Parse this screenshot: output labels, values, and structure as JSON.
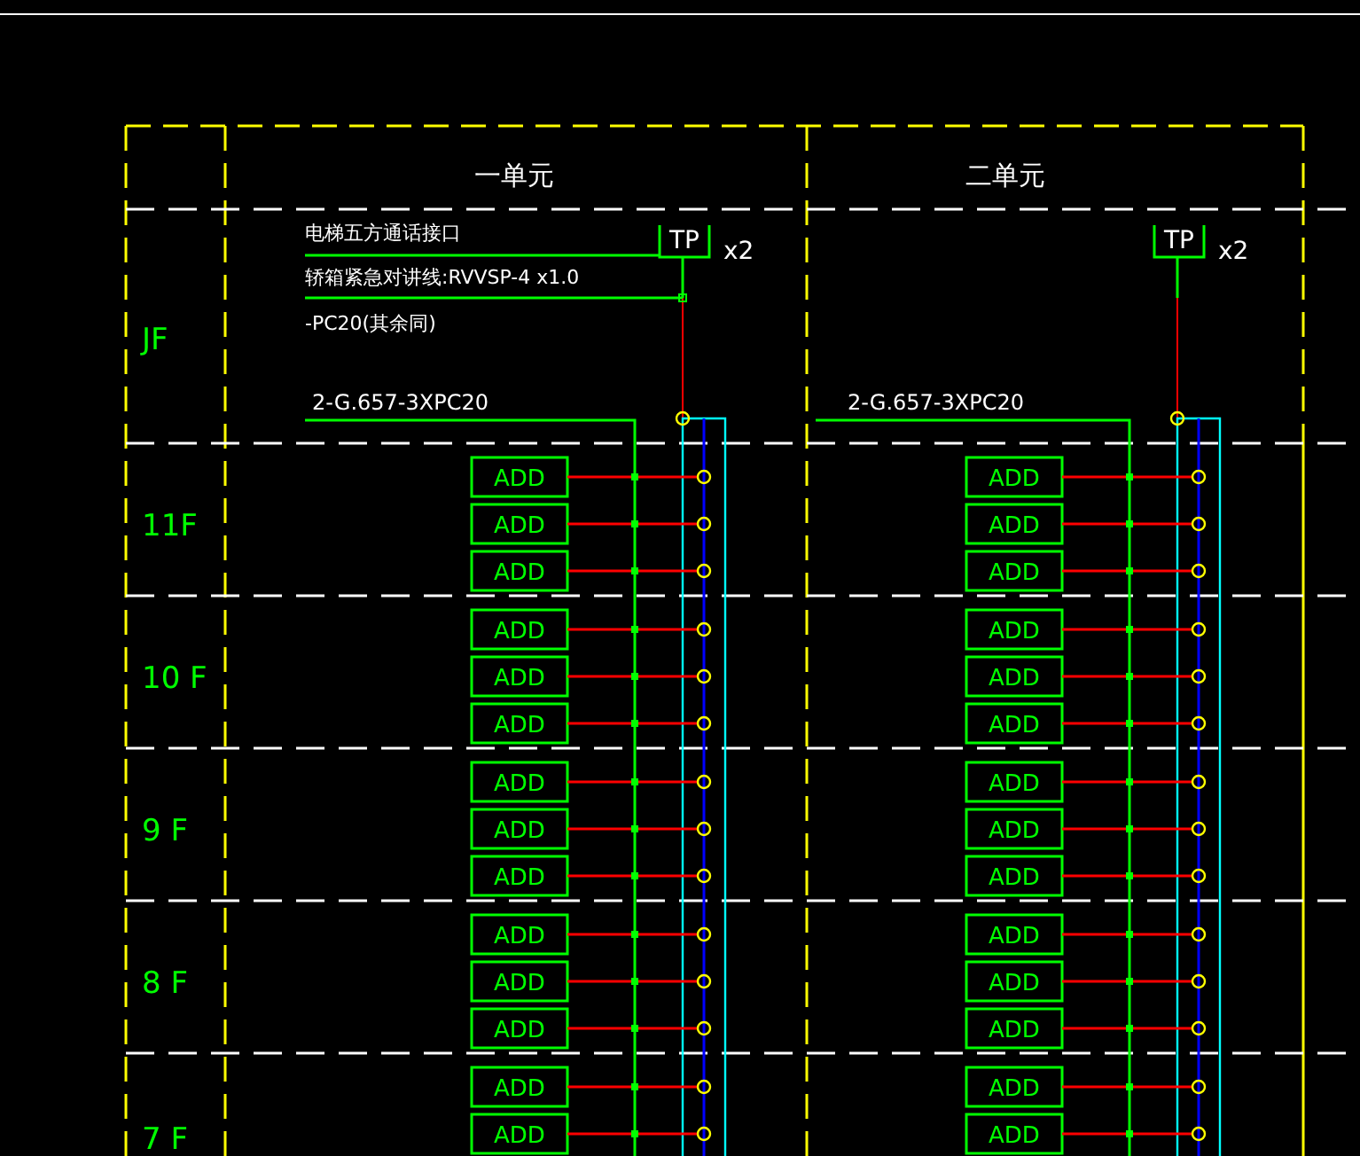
{
  "drawing": {
    "floors": [
      {
        "label": "JF"
      },
      {
        "label": "11F"
      },
      {
        "label": "10 F"
      },
      {
        "label": "9 F"
      },
      {
        "label": "8 F"
      },
      {
        "label": "7 F"
      }
    ],
    "units": [
      {
        "title": "一单元",
        "tp": "TP",
        "tp_count": "x2",
        "notes": [
          "电梯五方通话接口",
          "轿箱紧急对讲线:RVVSP-4 x1.0",
          "-PC20(其余同)"
        ],
        "cable": "2-G.657-3XPC20",
        "floor_devices": [
          [
            "ADD",
            "ADD",
            "ADD"
          ],
          [
            "ADD",
            "ADD",
            "ADD"
          ],
          [
            "ADD",
            "ADD",
            "ADD"
          ],
          [
            "ADD",
            "ADD",
            "ADD"
          ],
          [
            "ADD",
            "ADD"
          ]
        ]
      },
      {
        "title": "二单元",
        "tp": "TP",
        "tp_count": "x2",
        "cable": "2-G.657-3XPC20",
        "floor_devices": [
          [
            "ADD",
            "ADD",
            "ADD"
          ],
          [
            "ADD",
            "ADD",
            "ADD"
          ],
          [
            "ADD",
            "ADD",
            "ADD"
          ],
          [
            "ADD",
            "ADD",
            "ADD"
          ],
          [
            "ADD",
            "ADD"
          ]
        ]
      }
    ]
  }
}
